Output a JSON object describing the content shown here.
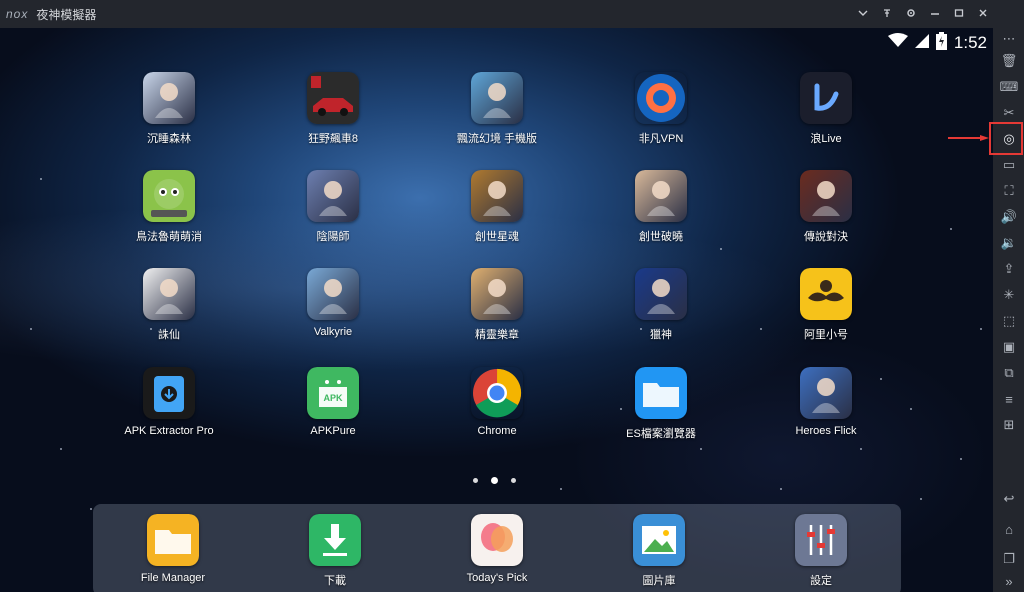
{
  "window": {
    "logo": "nox",
    "title": "夜神模擬器",
    "controls": [
      "chevron-down-icon",
      "pin-icon",
      "settings-icon",
      "minimize-icon",
      "maximize-icon",
      "close-icon"
    ]
  },
  "status": {
    "time": "1:52"
  },
  "apps": [
    {
      "label": "沉睡森林",
      "icon": "game-icon",
      "color": "#c9d6ea"
    },
    {
      "label": "狂野飆車8",
      "icon": "racing-icon",
      "color": "#c0242b"
    },
    {
      "label": "飄流幻境 手機版",
      "icon": "game-icon",
      "color": "#5fa6d8"
    },
    {
      "label": "非凡VPN",
      "icon": "vpn-icon",
      "color": "#1565c0"
    },
    {
      "label": "浪Live",
      "icon": "live-icon",
      "color": "#1b1e2c"
    },
    {
      "label": "鳥法魯萌萌消",
      "icon": "bird-icon",
      "color": "#8bc34a"
    },
    {
      "label": "陰陽師",
      "icon": "game-icon",
      "color": "#6d7fb0"
    },
    {
      "label": "創世星魂",
      "icon": "game-icon",
      "color": "#b07a2f"
    },
    {
      "label": "創世破曉",
      "icon": "game-icon",
      "color": "#d9b99a"
    },
    {
      "label": "傳說對決",
      "icon": "game-icon",
      "color": "#6b2b1f"
    },
    {
      "label": "誅仙",
      "icon": "game-icon",
      "color": "#f1f1f1"
    },
    {
      "label": "Valkyrie",
      "icon": "game-icon",
      "color": "#7aa9d6"
    },
    {
      "label": "精靈樂章",
      "icon": "game-icon",
      "color": "#e0b070"
    },
    {
      "label": "獵神",
      "icon": "game-icon",
      "color": "#1a3a8a"
    },
    {
      "label": "阿里小号",
      "icon": "mustache-icon",
      "color": "#f6c21a"
    },
    {
      "label": "APK Extractor Pro",
      "icon": "android-icon",
      "color": "#1a1a1a"
    },
    {
      "label": "APKPure",
      "icon": "apk-icon",
      "color": "#3fb861"
    },
    {
      "label": "Chrome",
      "icon": "chrome-icon",
      "color": "#ffffff"
    },
    {
      "label": "ES檔案瀏覽器",
      "icon": "folder-icon",
      "color": "#2196f3"
    },
    {
      "label": "Heroes Flick",
      "icon": "game-icon",
      "color": "#3d6fc0"
    }
  ],
  "dock": [
    {
      "label": "File Manager",
      "icon": "folder-icon",
      "color": "#f5b323"
    },
    {
      "label": "下載",
      "icon": "download-icon",
      "color": "#2eb766"
    },
    {
      "label": "Today's Pick",
      "icon": "balloon-icon",
      "color": "#f7f1ee"
    },
    {
      "label": "圖片庫",
      "icon": "gallery-icon",
      "color": "#3a8fd6"
    },
    {
      "label": "設定",
      "icon": "settings-sliders-icon",
      "color": "#6d7894"
    }
  ],
  "sidebar": [
    "more-icon",
    "trash-icon",
    "keyboard-icon",
    "scissors-icon",
    "location-icon",
    "screen-icon",
    "fullscreen-icon",
    "volume-up-icon",
    "volume-down-icon",
    "apk-install-icon",
    "shake-icon",
    "screenshot-icon",
    "record-icon",
    "multi-instance-icon",
    "menu-icon",
    "add-icon",
    "back-icon",
    "home-icon",
    "recent-apps-icon",
    "expand-icon"
  ],
  "pager": {
    "pages": 3,
    "current": 2
  }
}
